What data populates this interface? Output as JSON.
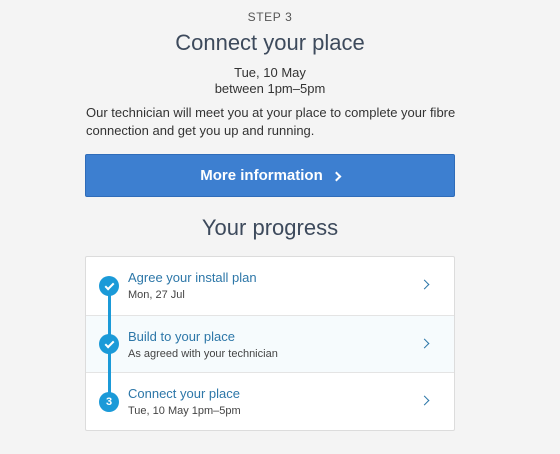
{
  "header": {
    "step_label": "STEP 3",
    "title": "Connect your place",
    "date": "Tue, 10 May",
    "time_window": "between 1pm–5pm",
    "description": "Our technician will meet you at your place to complete your fibre connection and get you up and running."
  },
  "more_info_button": {
    "label": "More information"
  },
  "progress": {
    "title": "Your progress",
    "items": [
      {
        "label": "Agree your install plan",
        "subtitle": "Mon, 27 Jul",
        "status": "complete"
      },
      {
        "label": "Build to your place",
        "subtitle": "As agreed with your technician",
        "status": "complete"
      },
      {
        "label": "Connect your place",
        "subtitle": "Tue, 10 May 1pm–5pm",
        "status": "current",
        "step_number": "3"
      }
    ]
  },
  "colors": {
    "accent": "#1b9ad8",
    "button": "#3d7fd0",
    "link": "#2d77a8"
  }
}
